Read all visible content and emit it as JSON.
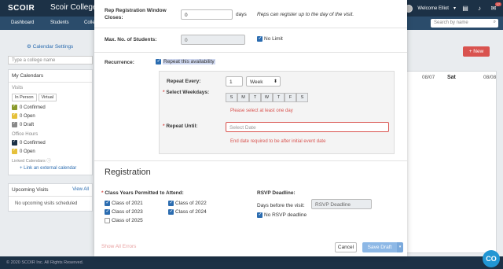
{
  "topbar": {
    "logo": "SCOIR",
    "college_title": "Scoir College",
    "welcome": "Welcome Elliot",
    "notif_count": "17"
  },
  "nav": {
    "items": [
      "Dashboard",
      "Students",
      "Colle"
    ],
    "search_placeholder": "Search by name"
  },
  "sidebar": {
    "calendar_settings": "Calendar Settings",
    "college_search_placeholder": "Type a college name",
    "my_calendars": "My Calendars",
    "visits_label": "Visits",
    "segments": [
      "In Person",
      "Virtual"
    ],
    "visit_statuses": [
      {
        "label": "0 Confirmed",
        "color": "#8a9a2b"
      },
      {
        "label": "0 Open",
        "color": "#e5c03a"
      },
      {
        "label": "0 Draft",
        "color": "#888888"
      }
    ],
    "office_hours_label": "Office Hours",
    "office_statuses": [
      {
        "label": "0 Confirmed",
        "color": "#1c3146"
      },
      {
        "label": "0 Open",
        "color": "#e5c03a"
      }
    ],
    "linked_calendars": "Linked Calendars",
    "add_external": "+ Link an external calendar",
    "upcoming_visits": "Upcoming Visits",
    "view_all": "View All",
    "no_upcoming": "No upcoming visits scheduled"
  },
  "calendar": {
    "new_button": "+ New",
    "dates": [
      "08/07",
      "Sat",
      "08/08"
    ]
  },
  "modal": {
    "rep_reg_label": "Rep Registration Window Closes:",
    "rep_reg_value": "0",
    "rep_reg_unit": "days",
    "rep_reg_help": "Reps can register up to the day of the visit.",
    "max_students_label": "Max. No. of Students:",
    "max_students_value": "0",
    "no_limit": "No Limit",
    "recurrence_label": "Recurrence:",
    "repeat_availability": "Repeat this availability",
    "repeat_every_label": "Repeat Every:",
    "repeat_every_value": "1",
    "repeat_unit": "Week",
    "select_weekdays_label": "Select Weekdays:",
    "weekdays": [
      "S",
      "M",
      "T",
      "W",
      "T",
      "F",
      "S"
    ],
    "weekdays_error": "Please select at least one day",
    "repeat_until_label": "Repeat Until:",
    "repeat_until_placeholder": "Select Date",
    "repeat_until_error": "End date required to be after initial event date",
    "registration_title": "Registration",
    "class_years_label": "Class Years Permitted to Attend:",
    "class_years": [
      {
        "label": "Class of 2021",
        "checked": true
      },
      {
        "label": "Class of 2022",
        "checked": true
      },
      {
        "label": "Class of 2023",
        "checked": true
      },
      {
        "label": "Class of 2024",
        "checked": true
      },
      {
        "label": "Class of 2025",
        "checked": false
      }
    ],
    "rsvp_label": "RSVP Deadline:",
    "days_before_label": "Days before the visit:",
    "rsvp_placeholder": "RSVP Deadline",
    "no_rsvp": "No RSVP deadline",
    "show_errors": "Show All Errors",
    "cancel": "Cancel",
    "save_draft": "Save Draft"
  },
  "footer": {
    "copyright": "© 2020 SCOIR Inc. All Rights Reserved.",
    "chat_label": "CO"
  }
}
